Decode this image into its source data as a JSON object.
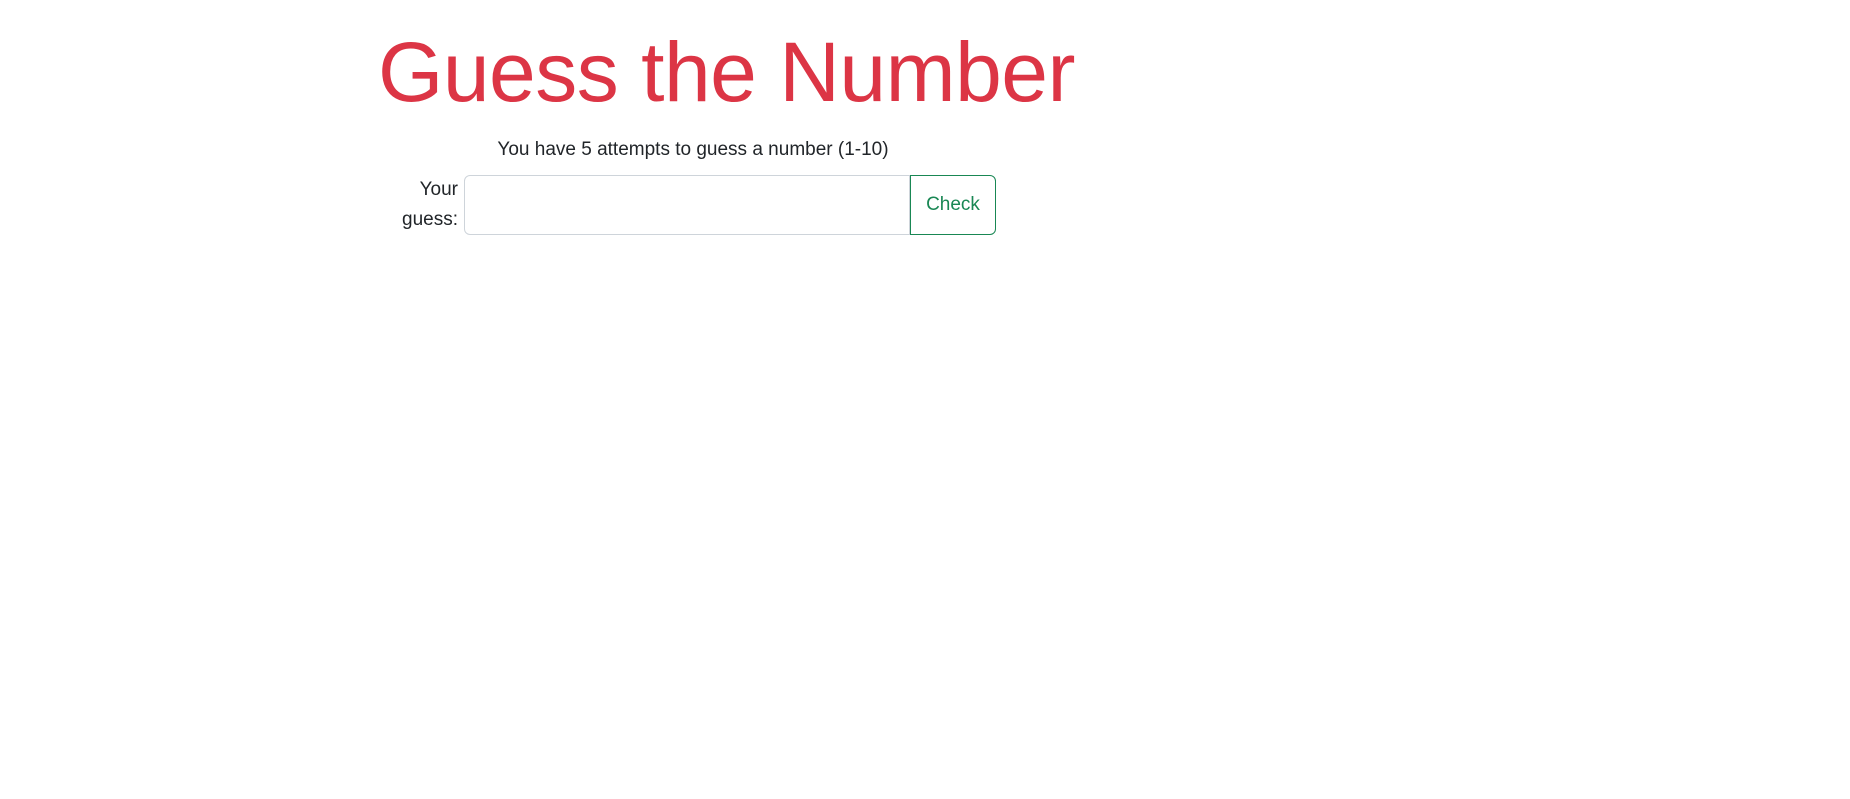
{
  "game": {
    "title": "Guess the Number",
    "instructions": "You have 5 attempts to guess a number (1-10)"
  },
  "form": {
    "label_line1": "Your",
    "label_line2": "guess:",
    "guess_value": "",
    "guess_placeholder": "",
    "check_label": "Check"
  },
  "colors": {
    "title": "#dc3545",
    "text": "#212529",
    "button_outline": "#198754",
    "input_border": "#ced4da"
  }
}
